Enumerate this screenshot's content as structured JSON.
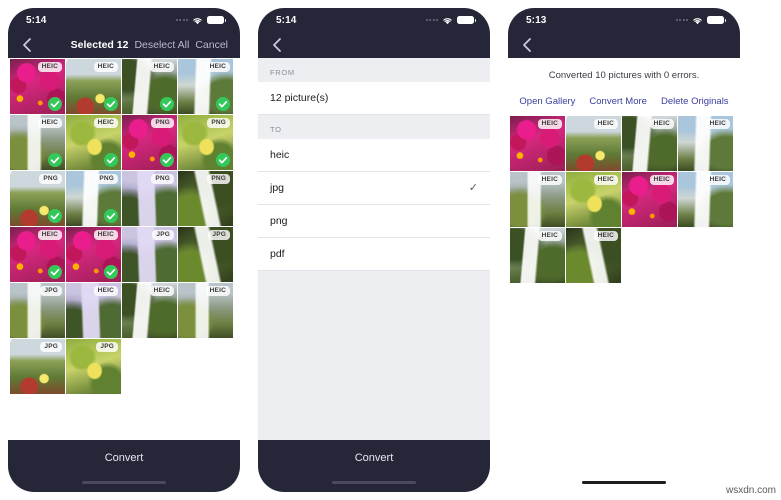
{
  "app": {
    "watermark": "wsxdn.com"
  },
  "screens": [
    {
      "id": "selection",
      "status": {
        "time": "5:14",
        "wifi_icon": "wifi-icon",
        "battery_icon": "battery-icon",
        "signal_icon": "signal-dots-icon"
      },
      "nav": {
        "back_icon": "chevron-left-icon",
        "title": "Selected 12",
        "deselect_label": "Deselect All",
        "cancel_label": "Cancel"
      },
      "grid": [
        {
          "badge": "HEIC",
          "selected": true,
          "pic": "flowers"
        },
        {
          "badge": "HEIC",
          "selected": true,
          "pic": "field"
        },
        {
          "badge": "HEIC",
          "selected": true,
          "pic": "fallA"
        },
        {
          "badge": "HEIC",
          "selected": true,
          "pic": "bluefall"
        },
        {
          "badge": "HEIC",
          "selected": true,
          "pic": "cliff"
        },
        {
          "badge": "HEIC",
          "selected": true,
          "pic": "leaf"
        },
        {
          "badge": "PNG",
          "selected": true,
          "pic": "flowers"
        },
        {
          "badge": "PNG",
          "selected": true,
          "pic": "leaf"
        },
        {
          "badge": "PNG",
          "selected": true,
          "pic": "field"
        },
        {
          "badge": "PNG",
          "selected": true,
          "pic": "bluefall"
        },
        {
          "badge": "PNG",
          "selected": false,
          "pic": "purplefall"
        },
        {
          "badge": "PNG",
          "selected": false,
          "pic": "mossy"
        },
        {
          "badge": "HEIC",
          "selected": true,
          "pic": "flowers"
        },
        {
          "badge": "HEIC",
          "selected": true,
          "pic": "flowers"
        },
        {
          "badge": "JPG",
          "selected": false,
          "pic": "purplefall"
        },
        {
          "badge": "JPG",
          "selected": false,
          "pic": "mossy"
        },
        {
          "badge": "JPG",
          "selected": false,
          "pic": "cliff"
        },
        {
          "badge": "HEIC",
          "selected": false,
          "pic": "purplefall"
        },
        {
          "badge": "HEIC",
          "selected": false,
          "pic": "fallA"
        },
        {
          "badge": "HEIC",
          "selected": false,
          "pic": "cliff"
        },
        {
          "badge": "JPG",
          "selected": false,
          "pic": "field"
        },
        {
          "badge": "JPG",
          "selected": false,
          "pic": "leaf"
        }
      ],
      "bottom": {
        "convert_label": "Convert"
      }
    },
    {
      "id": "format",
      "status": {
        "time": "5:14",
        "wifi_icon": "wifi-icon",
        "battery_icon": "battery-icon",
        "signal_icon": "signal-dots-icon"
      },
      "nav": {
        "back_icon": "chevron-left-icon"
      },
      "from": {
        "section_label": "FROM",
        "value": "12 picture(s)"
      },
      "to": {
        "section_label": "TO",
        "options": [
          {
            "label": "heic",
            "selected": false
          },
          {
            "label": "jpg",
            "selected": true
          },
          {
            "label": "png",
            "selected": false
          },
          {
            "label": "pdf",
            "selected": false
          }
        ],
        "check_glyph": "✓"
      },
      "bottom": {
        "convert_label": "Convert"
      }
    },
    {
      "id": "result",
      "status": {
        "time": "5:13",
        "wifi_icon": "wifi-icon",
        "battery_icon": "battery-icon",
        "signal_icon": "signal-dots-icon"
      },
      "nav": {
        "back_icon": "chevron-left-icon"
      },
      "result": {
        "message": "Converted 10 pictures with 0 errors.",
        "actions": [
          {
            "label": "Open Gallery"
          },
          {
            "label": "Convert More"
          },
          {
            "label": "Delete Originals"
          }
        ]
      },
      "grid": [
        {
          "badge": "HEIC",
          "pic": "flowers"
        },
        {
          "badge": "HEIC",
          "pic": "field"
        },
        {
          "badge": "HEIC",
          "pic": "fallA"
        },
        {
          "badge": "HEIC",
          "pic": "bluefall"
        },
        {
          "badge": "HEIC",
          "pic": "cliff"
        },
        {
          "badge": "HEIC",
          "pic": "leaf"
        },
        {
          "badge": "HEIC",
          "pic": "flowers"
        },
        {
          "badge": "HEIC",
          "pic": "bluefall"
        },
        {
          "badge": "HEIC",
          "pic": "fallA"
        },
        {
          "badge": "HEIC",
          "pic": "mossy"
        }
      ]
    }
  ],
  "colors": {
    "navbar": "#262639",
    "accent_check": "#34c759",
    "link": "#3b3f9e",
    "list_bg": "#eceef2"
  }
}
